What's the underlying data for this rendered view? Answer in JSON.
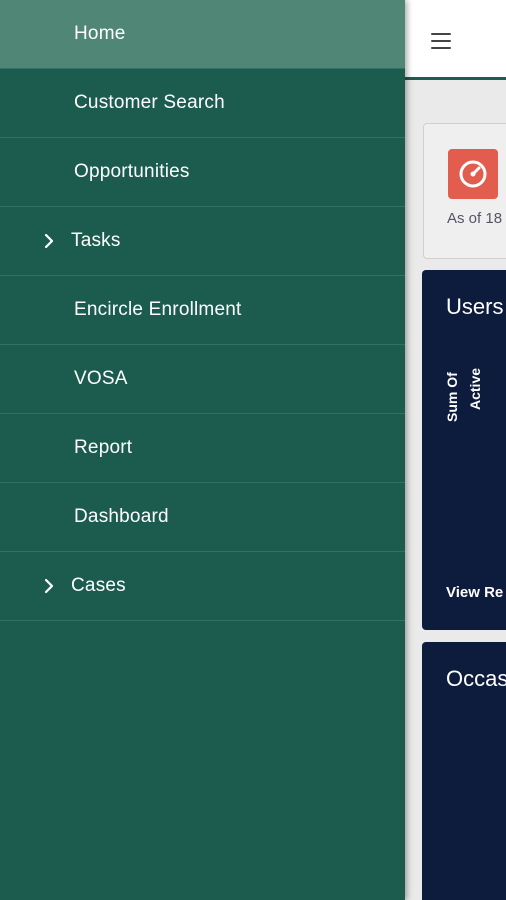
{
  "nav": {
    "items": [
      {
        "label": "Home",
        "active": true,
        "expandable": false
      },
      {
        "label": "Customer Search",
        "active": false,
        "expandable": false
      },
      {
        "label": "Opportunities",
        "active": false,
        "expandable": false
      },
      {
        "label": "Tasks",
        "active": false,
        "expandable": true
      },
      {
        "label": "Encircle Enrollment",
        "active": false,
        "expandable": false
      },
      {
        "label": "VOSA",
        "active": false,
        "expandable": false
      },
      {
        "label": "Report",
        "active": false,
        "expandable": false
      },
      {
        "label": "Dashboard",
        "active": false,
        "expandable": false
      },
      {
        "label": "Cases",
        "active": false,
        "expandable": true
      }
    ]
  },
  "main": {
    "gauge_card": {
      "as_of": "As of 18"
    },
    "card1": {
      "title": "Users",
      "axis_line1": "Sum Of",
      "axis_line2": "Active",
      "link": "View Re"
    },
    "card2": {
      "title": "Occas"
    }
  },
  "colors": {
    "drawer_bg": "#1b5c4f",
    "drawer_active": "#4f8676",
    "card_bg": "#0d1b3d",
    "gauge_icon_bg": "#e35d4f"
  },
  "icons": {
    "menu": "hamburger-icon",
    "chevron": "chevron-right-icon",
    "gauge": "gauge-icon"
  }
}
